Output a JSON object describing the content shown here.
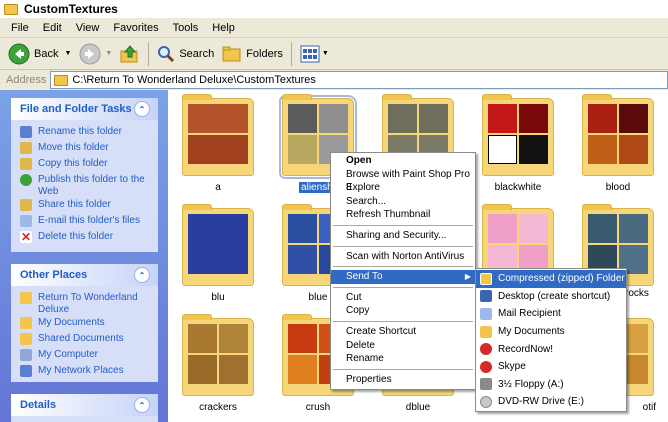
{
  "window": {
    "title": "CustomTextures"
  },
  "menu": [
    "File",
    "Edit",
    "View",
    "Favorites",
    "Tools",
    "Help"
  ],
  "toolbar": {
    "back": "Back",
    "search": "Search",
    "folders": "Folders"
  },
  "address": {
    "label": "Address",
    "path": "C:\\Return To Wonderland Deluxe\\CustomTextures"
  },
  "panels": {
    "tasks": {
      "title": "File and Folder Tasks",
      "items": [
        "Rename this folder",
        "Move this folder",
        "Copy this folder",
        "Publish this folder to the Web",
        "Share this folder",
        "E-mail this folder's files",
        "Delete this folder"
      ]
    },
    "places": {
      "title": "Other Places",
      "items": [
        "Return To Wonderland Deluxe",
        "My Documents",
        "Shared Documents",
        "My Computer",
        "My Network Places"
      ]
    },
    "details": {
      "title": "Details"
    }
  },
  "files": {
    "row1": [
      "a",
      "alienshi",
      "",
      "blackwhite",
      "blood"
    ],
    "row2": [
      "blu",
      "blue",
      "",
      "",
      "rocks"
    ],
    "row3": [
      "crackers",
      "crush",
      "dblue",
      "",
      "otif"
    ]
  },
  "context_menu": {
    "open": "Open",
    "browse": "Browse with Paint Shop Pro 8",
    "explore": "Explore",
    "search": "Search...",
    "refresh": "Refresh Thumbnail",
    "sharing": "Sharing and Security...",
    "scan": "Scan with Norton AntiVirus",
    "send_to": "Send To",
    "cut": "Cut",
    "copy": "Copy",
    "shortcut": "Create Shortcut",
    "delete": "Delete",
    "rename": "Rename",
    "properties": "Properties"
  },
  "send_to_menu": [
    "Compressed (zipped) Folder",
    "Desktop (create shortcut)",
    "Mail Recipient",
    "My Documents",
    "RecordNow!",
    "Skype",
    "3½ Floppy (A:)",
    "DVD-RW Drive (E:)"
  ]
}
